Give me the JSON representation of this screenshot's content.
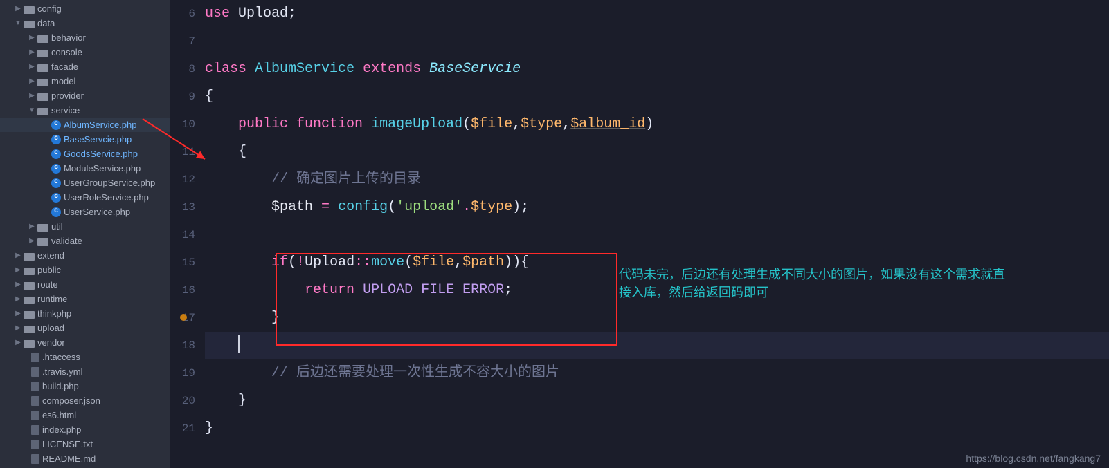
{
  "sidebar": {
    "items": [
      {
        "indent": 20,
        "chev": "▶",
        "icon": "folder",
        "label": "config"
      },
      {
        "indent": 20,
        "chev": "▼",
        "icon": "folder",
        "label": "data"
      },
      {
        "indent": 40,
        "chev": "▶",
        "icon": "folder",
        "label": "behavior"
      },
      {
        "indent": 40,
        "chev": "▶",
        "icon": "folder",
        "label": "console"
      },
      {
        "indent": 40,
        "chev": "▶",
        "icon": "folder",
        "label": "facade"
      },
      {
        "indent": 40,
        "chev": "▶",
        "icon": "folder",
        "label": "model"
      },
      {
        "indent": 40,
        "chev": "▶",
        "icon": "folder",
        "label": "provider"
      },
      {
        "indent": 40,
        "chev": "▼",
        "icon": "folder",
        "label": "service"
      },
      {
        "indent": 60,
        "chev": "",
        "icon": "php",
        "label": "AlbumService.php",
        "hl": true,
        "selected": true
      },
      {
        "indent": 60,
        "chev": "",
        "icon": "php",
        "label": "BaseServcie.php",
        "hl": true
      },
      {
        "indent": 60,
        "chev": "",
        "icon": "php",
        "label": "GoodsService.php",
        "hl": true
      },
      {
        "indent": 60,
        "chev": "",
        "icon": "php",
        "label": "ModuleService.php"
      },
      {
        "indent": 60,
        "chev": "",
        "icon": "php",
        "label": "UserGroupService.php"
      },
      {
        "indent": 60,
        "chev": "",
        "icon": "php",
        "label": "UserRoleService.php"
      },
      {
        "indent": 60,
        "chev": "",
        "icon": "php",
        "label": "UserService.php"
      },
      {
        "indent": 40,
        "chev": "▶",
        "icon": "folder",
        "label": "util"
      },
      {
        "indent": 40,
        "chev": "▶",
        "icon": "folder",
        "label": "validate"
      },
      {
        "indent": 20,
        "chev": "▶",
        "icon": "folder",
        "label": "extend"
      },
      {
        "indent": 20,
        "chev": "▶",
        "icon": "folder",
        "label": "public"
      },
      {
        "indent": 20,
        "chev": "▶",
        "icon": "folder",
        "label": "route"
      },
      {
        "indent": 20,
        "chev": "▶",
        "icon": "folder",
        "label": "runtime"
      },
      {
        "indent": 20,
        "chev": "▶",
        "icon": "folder",
        "label": "thinkphp"
      },
      {
        "indent": 20,
        "chev": "▶",
        "icon": "folder",
        "label": "upload"
      },
      {
        "indent": 20,
        "chev": "▶",
        "icon": "folder",
        "label": "vendor"
      },
      {
        "indent": 30,
        "chev": "",
        "icon": "file",
        "label": ".htaccess"
      },
      {
        "indent": 30,
        "chev": "",
        "icon": "file",
        "label": ".travis.yml"
      },
      {
        "indent": 30,
        "chev": "",
        "icon": "file",
        "label": "build.php"
      },
      {
        "indent": 30,
        "chev": "",
        "icon": "file",
        "label": "composer.json"
      },
      {
        "indent": 30,
        "chev": "",
        "icon": "file",
        "label": "es6.html"
      },
      {
        "indent": 30,
        "chev": "",
        "icon": "file",
        "label": "index.php"
      },
      {
        "indent": 30,
        "chev": "",
        "icon": "file",
        "label": "LICENSE.txt"
      },
      {
        "indent": 30,
        "chev": "",
        "icon": "file",
        "label": "README.md"
      }
    ]
  },
  "editor": {
    "line_numbers": [
      "6",
      "7",
      "8",
      "9",
      "10",
      "11",
      "12",
      "13",
      "14",
      "15",
      "16",
      "17",
      "18",
      "19",
      "20",
      "21"
    ],
    "code": {
      "l6": {
        "kw": "use",
        "sp": " ",
        "cls": "Upload",
        "semi": ";"
      },
      "l8": {
        "kw1": "class",
        "sp1": " ",
        "cls": "AlbumService",
        "sp2": " ",
        "kw2": "extends",
        "sp3": " ",
        "base": "BaseServcie"
      },
      "l9": "{",
      "l10": {
        "ind": "    ",
        "kw1": "public",
        "sp1": " ",
        "kw2": "function",
        "sp2": " ",
        "fn": "imageUpload",
        "open": "(",
        "p1": "$file",
        "c1": ",",
        "p2": "$type",
        "c2": ",",
        "p3": "$album_id",
        "close": ")"
      },
      "l11": {
        "ind": "    ",
        "brace": "{"
      },
      "l12": {
        "ind": "        ",
        "com": "// 确定图片上传的目录"
      },
      "l13": {
        "ind": "        ",
        "var": "$path",
        "sp": " ",
        "eq": "=",
        "sp2": " ",
        "fn": "config",
        "open": "(",
        "str": "'upload'",
        "dot": ".",
        "p": "$type",
        "close": ")",
        "semi": ";"
      },
      "l15": {
        "ind": "        ",
        "kw": "if",
        "open": "(",
        "not": "!",
        "cls": "Upload",
        "scope": "::",
        "fn": "move",
        "open2": "(",
        "p1": "$file",
        "c": ",",
        "p2": "$path",
        "close2": ")",
        "close": ")",
        "brace": "{"
      },
      "l16": {
        "ind": "            ",
        "kw": "return",
        "sp": " ",
        "const": "UPLOAD_FILE_ERROR",
        "semi": ";"
      },
      "l17": {
        "ind": "        ",
        "brace": "}"
      },
      "l19": {
        "ind": "        ",
        "com": "// 后边还需要处理一次性生成不容大小的图片"
      },
      "l20": {
        "ind": "    ",
        "brace": "}"
      },
      "l21": {
        "ind": "",
        "brace": "}"
      }
    }
  },
  "annotation": "代码未完，后边还有处理生成不同大小的图片，如果没有这个需求就直接入库，然后给返回码即可",
  "watermark": "https://blog.csdn.net/fangkang7"
}
